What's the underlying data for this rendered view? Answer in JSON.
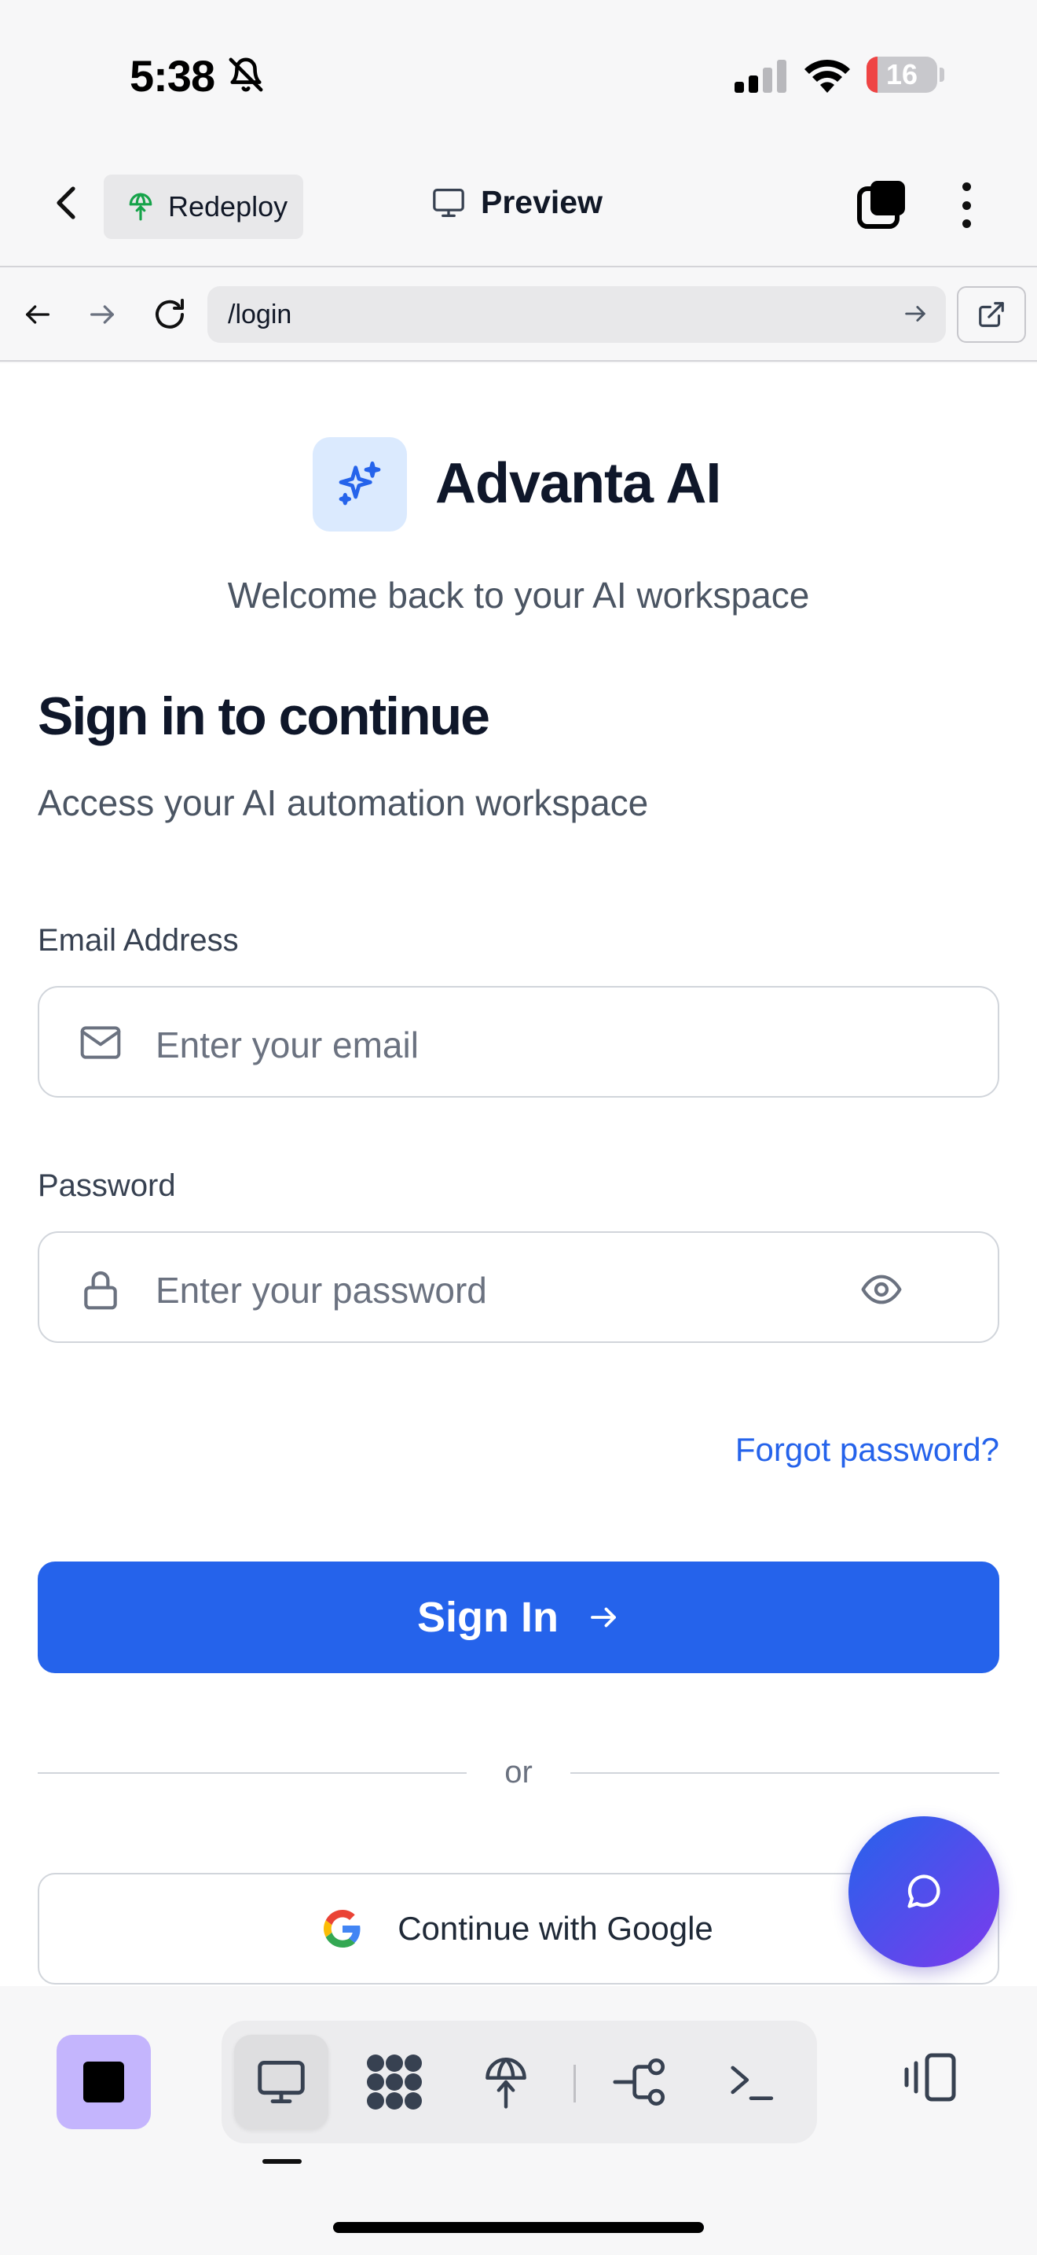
{
  "status_bar": {
    "time": "5:38",
    "battery_level": "16",
    "battery_fraction": 0.16,
    "icons": [
      "bell-slash-icon",
      "signal-icon",
      "wifi-icon",
      "battery-icon"
    ]
  },
  "header": {
    "redeploy_label": "Redeploy",
    "preview_label": "Preview"
  },
  "url_bar": {
    "path": "/login"
  },
  "page": {
    "brand_name": "Advanta AI",
    "tagline": "Welcome back to your AI workspace",
    "heading": "Sign in to continue",
    "subheading": "Access your AI automation workspace",
    "email": {
      "label": "Email Address",
      "placeholder": "Enter your email",
      "value": ""
    },
    "password": {
      "label": "Password",
      "placeholder": "Enter your password",
      "value": ""
    },
    "forgot_label": "Forgot password?",
    "signin_label": "Sign In",
    "divider_text": "or",
    "google_label": "Continue with Google"
  },
  "colors": {
    "accent": "#2563eb",
    "logo_tile": "#dbeafe",
    "stop_button": "#c4b5fd",
    "fab_gradient_start": "#2563eb",
    "fab_gradient_end": "#7c3aed"
  },
  "bottom_bar": {
    "tools": [
      "desktop-icon",
      "apps-grid-icon",
      "deploy-globe-icon",
      "workflow-icon",
      "terminal-icon"
    ],
    "active_tool": "desktop-icon"
  }
}
